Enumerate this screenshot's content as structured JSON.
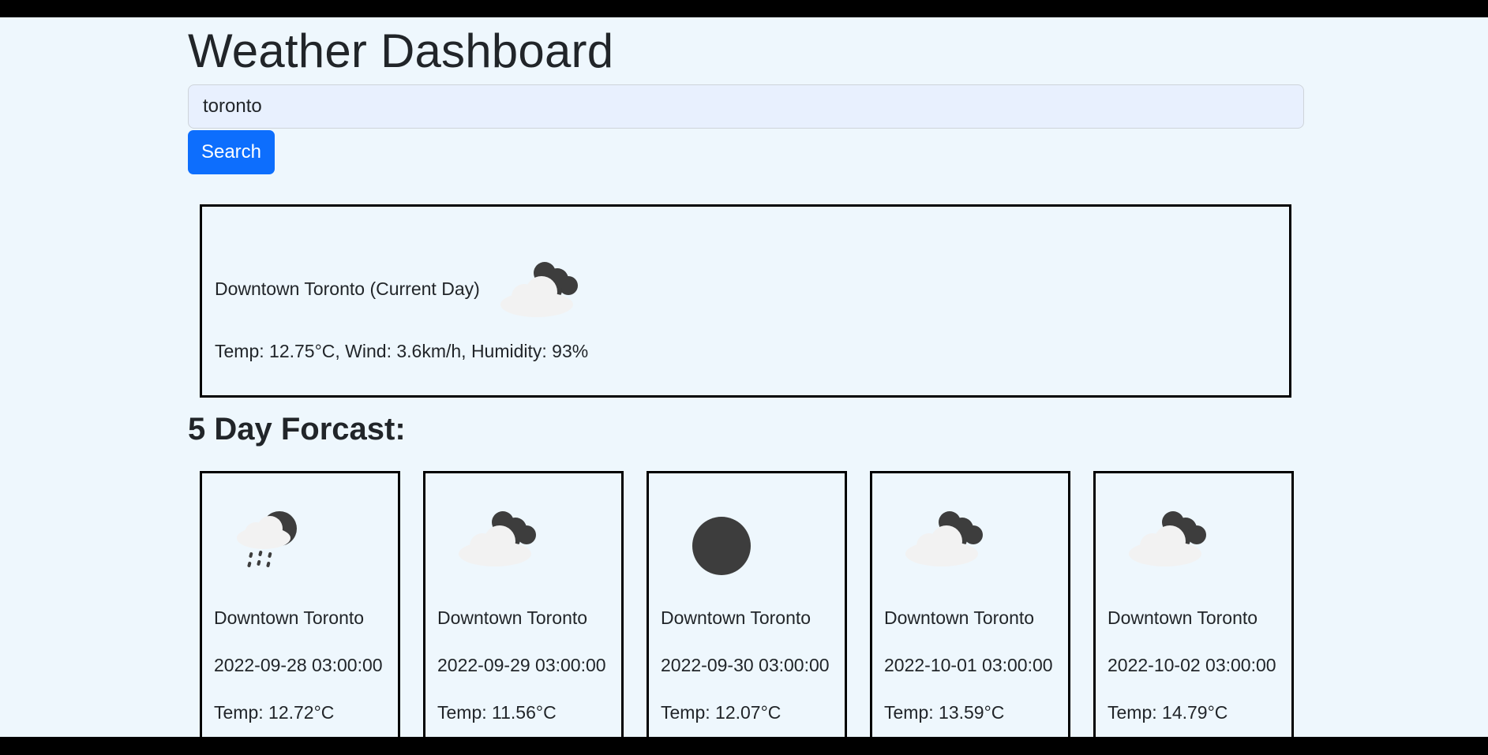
{
  "header": {
    "title": "Weather Dashboard"
  },
  "search": {
    "value": "toronto",
    "button_label": "Search"
  },
  "current": {
    "heading": "Downtown Toronto (Current Day)",
    "icon": "cloud-moon-icon",
    "stats": "Temp: 12.75°C, Wind: 3.6km/h, Humidity: 93%"
  },
  "forecast": {
    "heading": "5 Day Forcast:",
    "days": [
      {
        "city": "Downtown Toronto",
        "date": "2022-09-28 03:00:00",
        "temp": "Temp: 12.72°C",
        "icon": "rain-moon-icon"
      },
      {
        "city": "Downtown Toronto",
        "date": "2022-09-29 03:00:00",
        "temp": "Temp: 11.56°C",
        "icon": "cloud-moon-icon"
      },
      {
        "city": "Downtown Toronto",
        "date": "2022-09-30 03:00:00",
        "temp": "Temp: 12.07°C",
        "icon": "clear-night-icon"
      },
      {
        "city": "Downtown Toronto",
        "date": "2022-10-01 03:00:00",
        "temp": "Temp: 13.59°C",
        "icon": "cloud-moon-icon"
      },
      {
        "city": "Downtown Toronto",
        "date": "2022-10-02 03:00:00",
        "temp": "Temp: 14.79°C",
        "icon": "cloud-moon-icon"
      }
    ]
  },
  "colors": {
    "page_background": "#eef7fd",
    "button_primary": "#0d6efd",
    "input_background": "#e8f0fe",
    "cloud_light": "#f2f2f2",
    "cloud_dark": "#3d3d3d"
  }
}
